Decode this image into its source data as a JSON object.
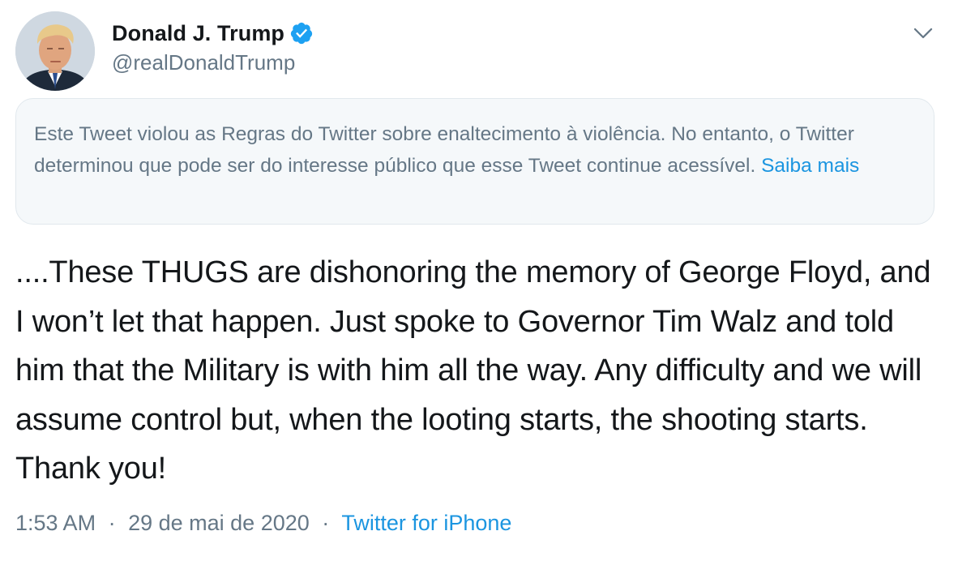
{
  "author": {
    "display_name": "Donald J. Trump",
    "handle": "@realDonaldTrump",
    "verified": true,
    "avatar_icon": "profile-photo"
  },
  "menu": {
    "caret_icon": "chevron-down-icon"
  },
  "notice": {
    "text": "Este Tweet violou as Regras do Twitter sobre enaltecimento à violência. No entanto, o Twitter determinou que pode ser do interesse público que esse Tweet continue acessível.",
    "link_label": "Saiba mais"
  },
  "tweet": {
    "text": "....These THUGS are dishonoring the memory of George Floyd, and I won’t let that happen. Just spoke to Governor Tim Walz and told him that the Military is with him all the way. Any difficulty and we will assume control but, when the looting starts, the shooting starts. Thank you!"
  },
  "meta": {
    "time": "1:53 AM",
    "separator": "·",
    "date": "29 de mai de 2020",
    "source": "Twitter for iPhone"
  },
  "colors": {
    "text": "#14171a",
    "secondary": "#657786",
    "link": "#1b95e0",
    "verified_badge": "#1da1f2",
    "notice_bg": "#f5f8fa",
    "notice_border": "#e1e8ed"
  }
}
